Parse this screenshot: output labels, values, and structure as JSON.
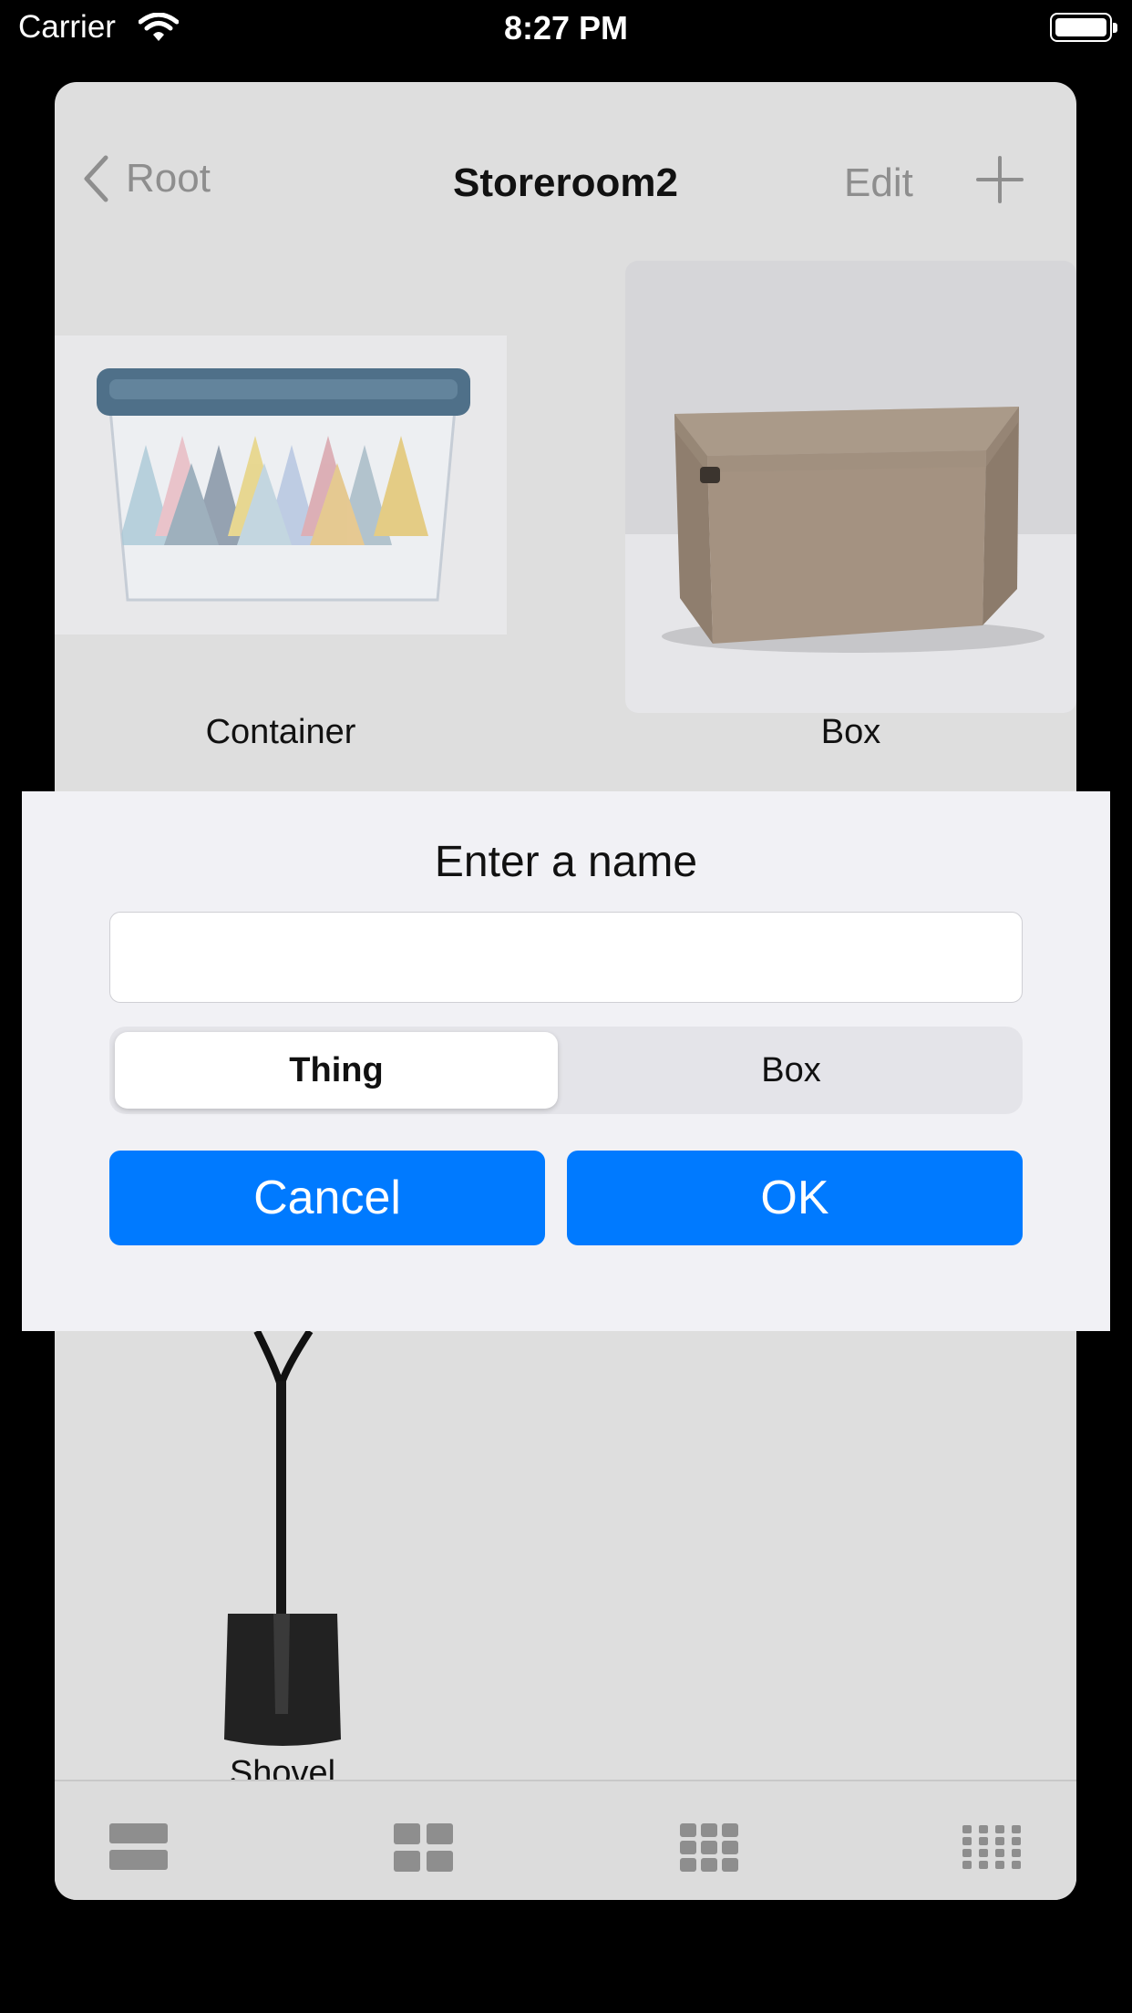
{
  "status_bar": {
    "carrier": "Carrier",
    "time": "8:27 PM"
  },
  "nav": {
    "back_label": "Root",
    "title": "Storeroom2",
    "edit_label": "Edit"
  },
  "items": [
    {
      "label": "Container",
      "image": "plastic-storage-container"
    },
    {
      "label": "Box",
      "image": "cardboard-box"
    },
    {
      "label": "Shovel",
      "image": "shovel"
    }
  ],
  "dialog": {
    "title": "Enter a name",
    "input_value": "",
    "segments": [
      {
        "label": "Thing",
        "selected": true
      },
      {
        "label": "Box",
        "selected": false
      }
    ],
    "cancel_label": "Cancel",
    "ok_label": "OK"
  },
  "toolbar": {
    "icons": [
      "grid-1-col-icon",
      "grid-2-col-icon",
      "grid-3-col-icon",
      "grid-4-col-icon"
    ]
  },
  "colors": {
    "accent": "#007aff",
    "sheet_bg": "#dedede",
    "dialog_bg": "#f1f1f5"
  }
}
